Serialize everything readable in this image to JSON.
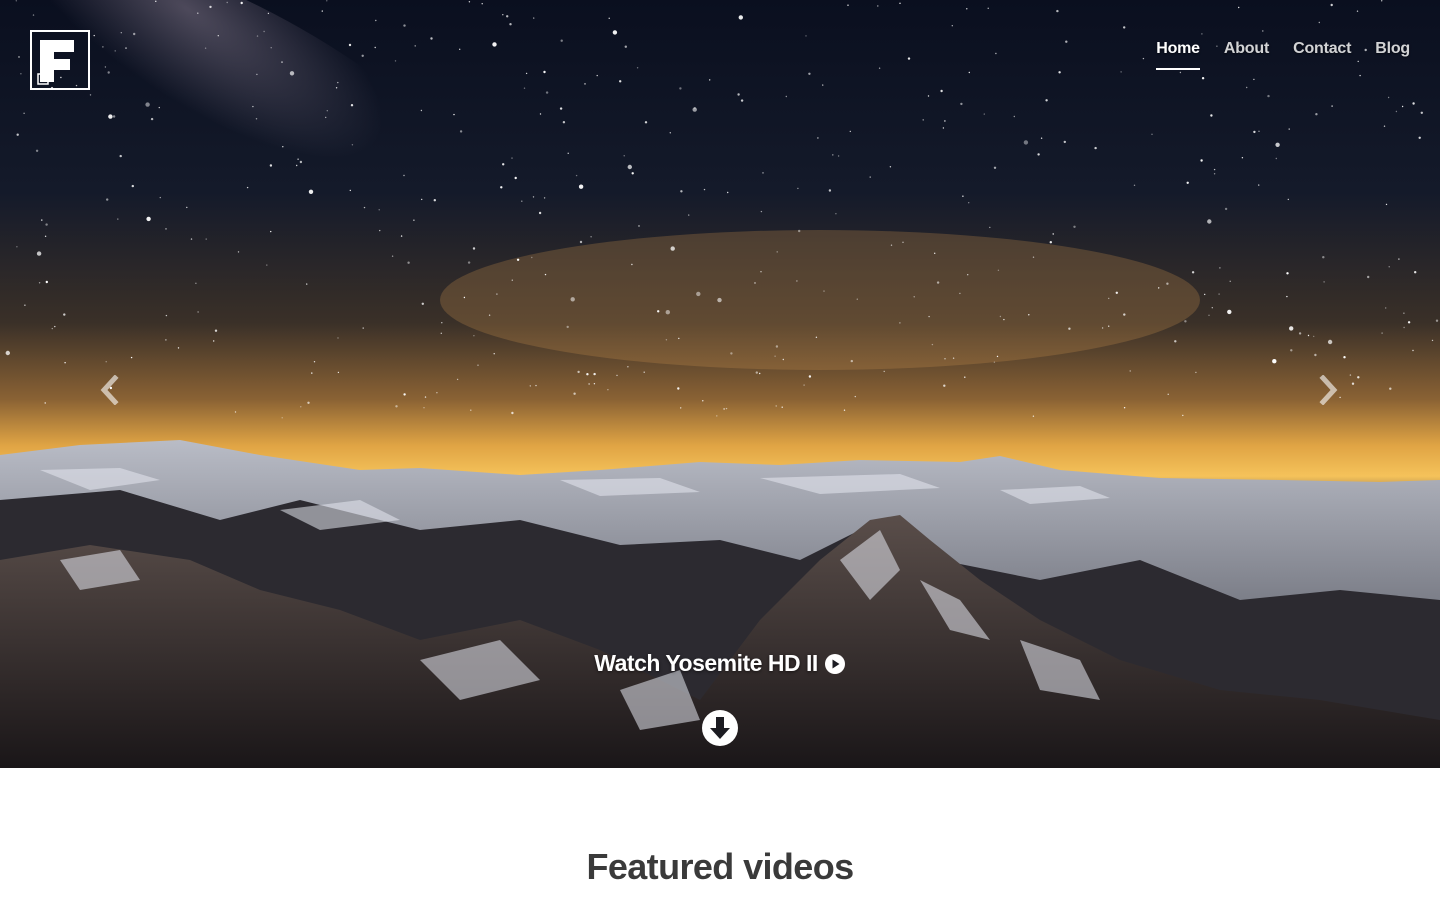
{
  "brand": {
    "logo_letter": "F",
    "logo_icon": "brand-f-logo-icon"
  },
  "nav": {
    "items": [
      {
        "label": "Home",
        "active": true
      },
      {
        "label": "About",
        "active": false
      },
      {
        "label": "Contact",
        "active": false
      },
      {
        "label": "Blog",
        "active": false
      }
    ]
  },
  "hero": {
    "background": "starry-night-mountain-landscape",
    "prev_icon": "chevron-left-icon",
    "next_icon": "chevron-right-icon",
    "cta_label": "Watch Yosemite HD II",
    "cta_icon": "play-circle-icon",
    "scroll_icon": "arrow-down-circle-icon"
  },
  "featured": {
    "heading": "Featured videos"
  },
  "colors": {
    "accent": "#ffffff",
    "heading": "#3a3a3a",
    "sky_top": "#0c1224",
    "horizon": "#f5b84a"
  }
}
